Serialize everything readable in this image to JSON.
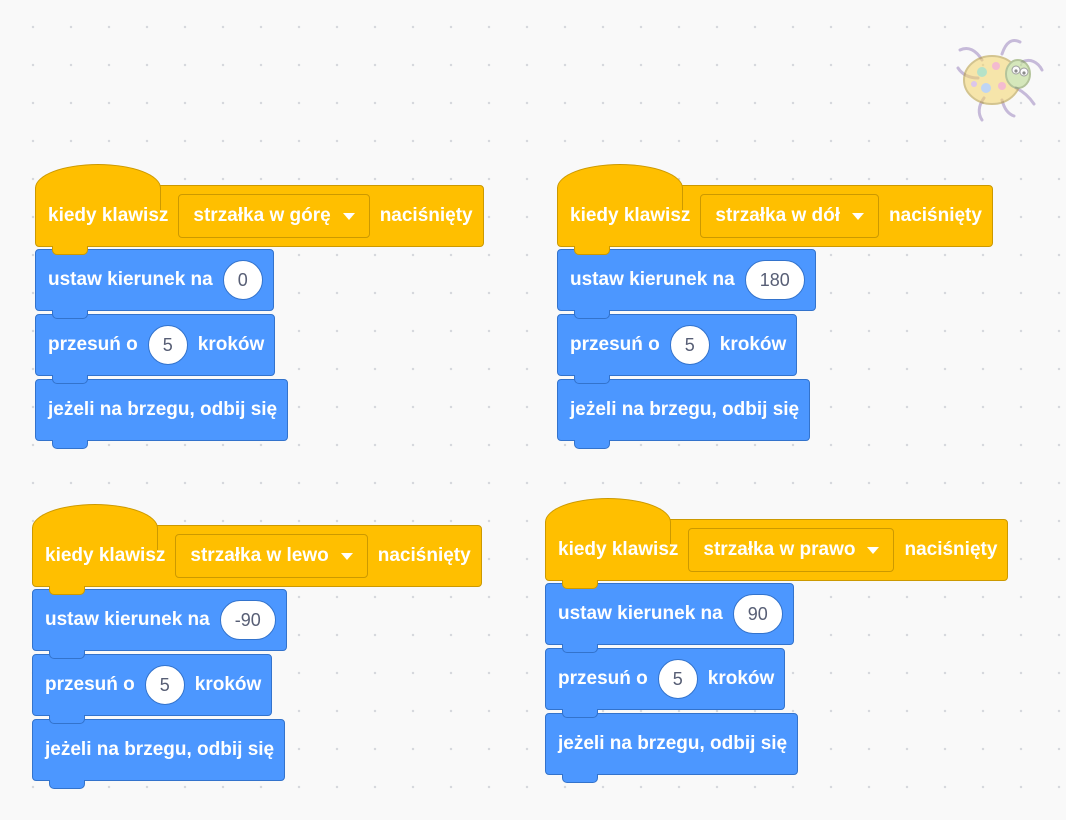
{
  "scripts": [
    {
      "hat": {
        "prefix": "kiedy klawisz",
        "key": "strzałka w górę",
        "suffix": "naciśnięty"
      },
      "set_direction": {
        "label": "ustaw kierunek na",
        "value": "0"
      },
      "move": {
        "label": "przesuń o",
        "value": "5",
        "suffix": "kroków"
      },
      "bounce": {
        "label": "jeżeli na brzegu, odbij się"
      }
    },
    {
      "hat": {
        "prefix": "kiedy klawisz",
        "key": "strzałka w dół",
        "suffix": "naciśnięty"
      },
      "set_direction": {
        "label": "ustaw kierunek na",
        "value": "180"
      },
      "move": {
        "label": "przesuń o",
        "value": "5",
        "suffix": "kroków"
      },
      "bounce": {
        "label": "jeżeli na brzegu, odbij się"
      }
    },
    {
      "hat": {
        "prefix": "kiedy klawisz",
        "key": "strzałka w lewo",
        "suffix": "naciśnięty"
      },
      "set_direction": {
        "label": "ustaw kierunek na",
        "value": "-90"
      },
      "move": {
        "label": "przesuń o",
        "value": "5",
        "suffix": "kroków"
      },
      "bounce": {
        "label": "jeżeli na brzegu, odbij się"
      }
    },
    {
      "hat": {
        "prefix": "kiedy klawisz",
        "key": "strzałka w prawo",
        "suffix": "naciśnięty"
      },
      "set_direction": {
        "label": "ustaw kierunek na",
        "value": "90"
      },
      "move": {
        "label": "przesuń o",
        "value": "5",
        "suffix": "kroków"
      },
      "bounce": {
        "label": "jeżeli na brzegu, odbij się"
      }
    }
  ],
  "sprite": {
    "icon": "ladybug-sprite-icon"
  },
  "colors": {
    "events": "#FFBF00",
    "events_border": "#CC9900",
    "motion": "#4C97FF",
    "motion_border": "#3373CC",
    "input_text": "#575E75",
    "workspace": "#F9F9F9"
  }
}
